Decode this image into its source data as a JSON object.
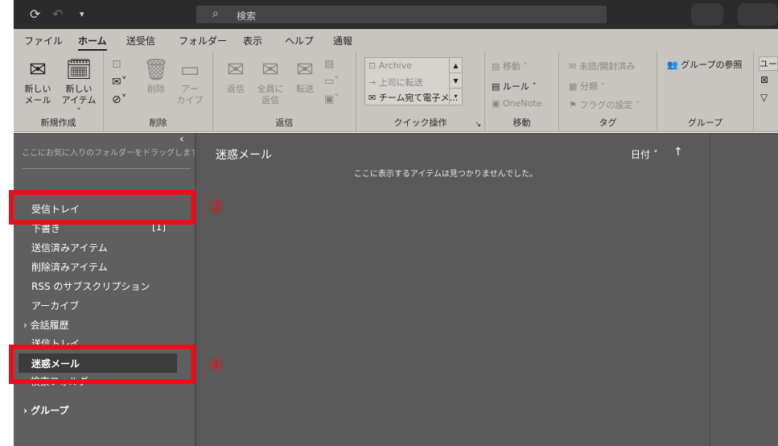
{
  "titlebar": {
    "sync_icon": "sync-icon",
    "undo_icon": "undo-icon",
    "customize_icon": "chevron-down-icon",
    "search_placeholder": "検索"
  },
  "menu": {
    "tabs": [
      "ファイル",
      "ホーム",
      "送受信",
      "フォルダー",
      "表示",
      "ヘルプ",
      "通報"
    ],
    "active_tab": "ホーム"
  },
  "ribbon": {
    "new": {
      "new_mail_l1": "新しい",
      "new_mail_l2": "メール",
      "new_item_l1": "新しい",
      "new_item_l2": "アイテム ˅",
      "label": "新規作成"
    },
    "delete": {
      "delete_label": "削除",
      "archive_l1": "アー",
      "archive_l2": "カイブ",
      "label": "削除"
    },
    "respond": {
      "reply": "返信",
      "reply_all_l1": "全員に",
      "reply_all_l2": "返信",
      "forward": "転送",
      "label": "返信"
    },
    "quick_steps": {
      "items": [
        "Archive",
        "上司に転送",
        "チーム宛て電子メ…"
      ],
      "label": "クイック操作"
    },
    "move": {
      "move": "移動 ˅",
      "rules": "ルール ˅",
      "onenote": "OneNote",
      "label": "移動"
    },
    "tags": {
      "unread_read": "未読/開封済み",
      "categorize": "分類 ˅",
      "followup": "フラグの設定 ˅",
      "label": "タグ"
    },
    "groups": {
      "browse": "グループの参照",
      "label": "グループ"
    },
    "find": {
      "user_search": "ユー"
    }
  },
  "folder_pane": {
    "favorites_hint": "ここにお気に入りのフォルダーをドラッグします",
    "folders": [
      {
        "label": "受信トレイ"
      },
      {
        "label": "下書き",
        "count": "[1]"
      },
      {
        "label": "送信済みアイテム"
      },
      {
        "label": "削除済みアイテム"
      },
      {
        "label": "RSS のサブスクリプション"
      },
      {
        "label": "アーカイブ"
      },
      {
        "label": "会話履歴"
      },
      {
        "label": "送信トレイ"
      },
      {
        "label": "迷惑メール"
      },
      {
        "label": "検索フォルダー"
      }
    ],
    "group_label": "グループ"
  },
  "message_list": {
    "folder_title": "迷惑メール",
    "sort_by": "日付 ˅",
    "sort_dir": "↑",
    "empty_text": "ここに表示するアイテムは見つかりませんでした。"
  },
  "annotations": {
    "n3": "③",
    "n4": "④",
    "color": "#e8101a"
  }
}
